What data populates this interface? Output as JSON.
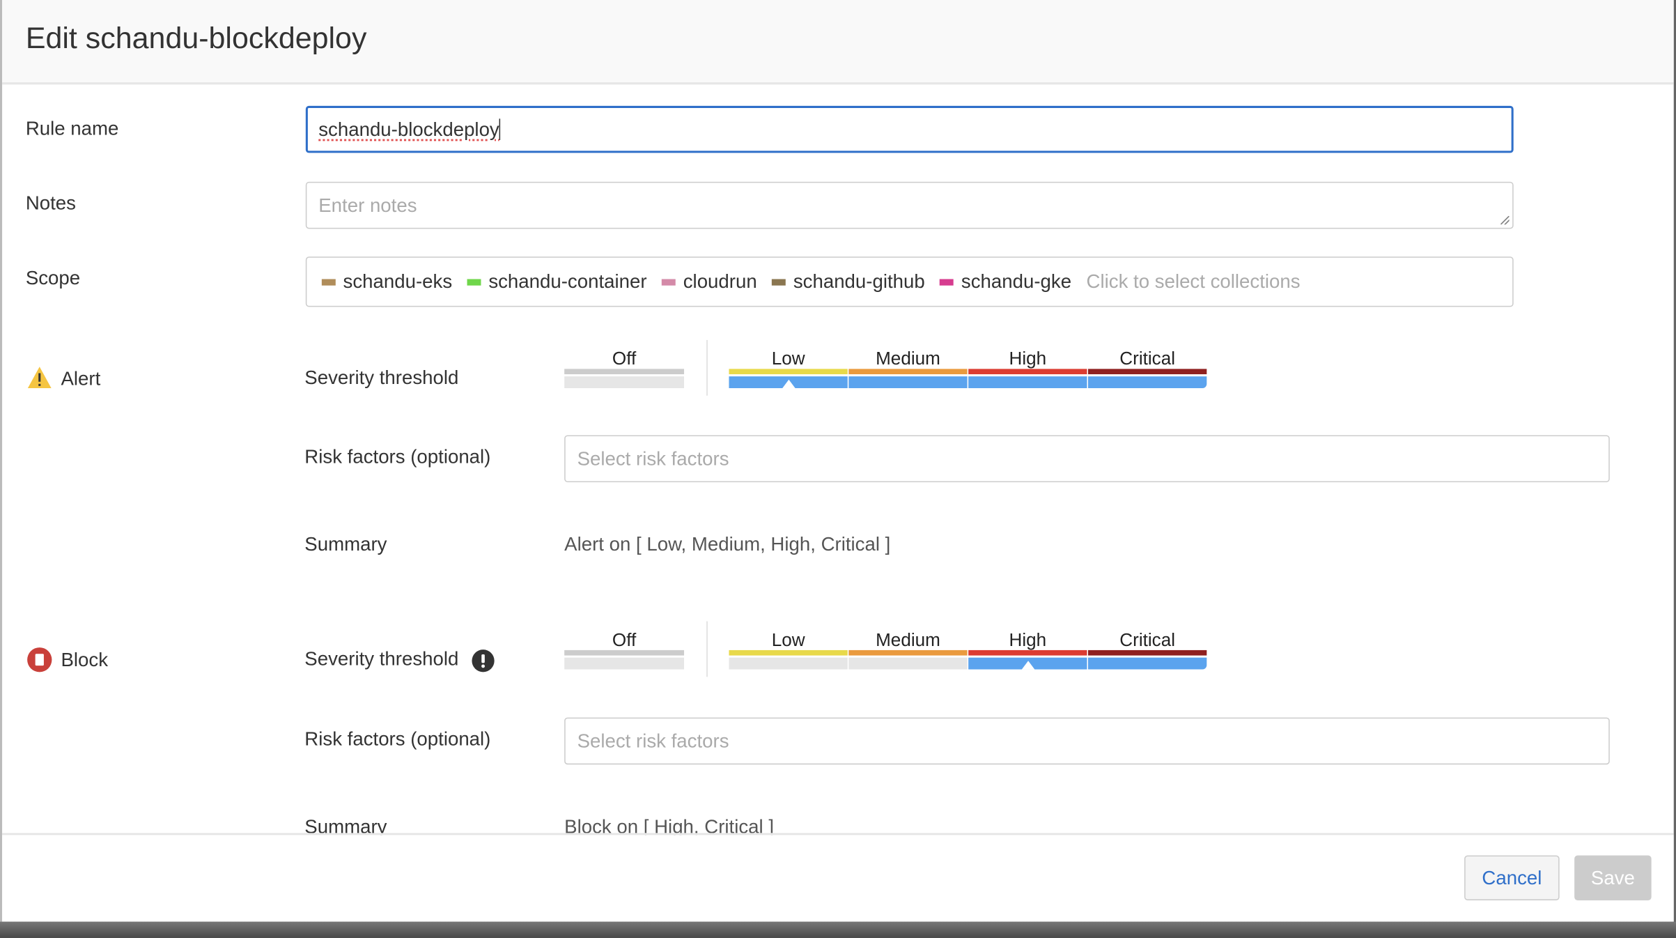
{
  "title": "Edit schandu-blockdeploy",
  "rule_name": {
    "label": "Rule name",
    "value": "schandu-blockdeploy"
  },
  "notes": {
    "label": "Notes",
    "placeholder": "Enter notes"
  },
  "scope": {
    "label": "Scope",
    "collections": [
      {
        "name": "schandu-eks",
        "color": "#b08d5a"
      },
      {
        "name": "schandu-container",
        "color": "#6fd64a"
      },
      {
        "name": "cloudrun",
        "color": "#d48aa8"
      },
      {
        "name": "schandu-github",
        "color": "#8a7650"
      },
      {
        "name": "schandu-gke",
        "color": "#d63c8f"
      }
    ],
    "placeholder": "Click to select collections"
  },
  "severity_levels": [
    {
      "label": "Off",
      "color": "#cccccc"
    },
    {
      "label": "Low",
      "color": "#e8d94a"
    },
    {
      "label": "Medium",
      "color": "#ea9a3e"
    },
    {
      "label": "High",
      "color": "#dc3c32"
    },
    {
      "label": "Critical",
      "color": "#8f2020"
    }
  ],
  "alert": {
    "label": "Alert",
    "severity_label": "Severity threshold",
    "threshold": "Low",
    "risk_label": "Risk factors (optional)",
    "risk_placeholder": "Select risk factors",
    "summary_label": "Summary",
    "summary": "Alert on [ Low, Medium, High, Critical ]"
  },
  "block": {
    "label": "Block",
    "severity_label": "Severity threshold",
    "threshold": "High",
    "risk_label": "Risk factors (optional)",
    "risk_placeholder": "Select risk factors",
    "summary_label": "Summary",
    "summary": "Block on [ High, Critical ]"
  },
  "footer": {
    "cancel": "Cancel",
    "save": "Save"
  },
  "colors": {
    "accent": "#2f6fc9",
    "active_segment": "#5ba3ee",
    "alert_icon": "#f5c542",
    "block_icon": "#c9403a"
  }
}
